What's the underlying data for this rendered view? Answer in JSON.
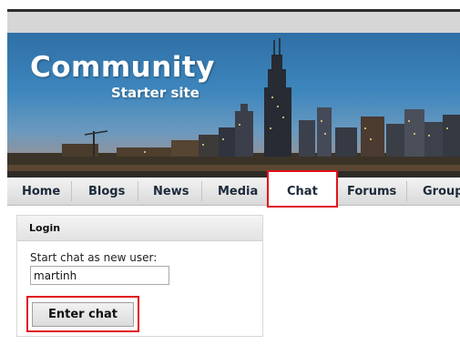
{
  "banner": {
    "title": "Community",
    "subtitle": "Starter site"
  },
  "nav": {
    "items": [
      {
        "label": "Home"
      },
      {
        "label": "Blogs"
      },
      {
        "label": "News"
      },
      {
        "label": "Media"
      },
      {
        "label": "Chat"
      },
      {
        "label": "Forums"
      },
      {
        "label": "Group"
      }
    ],
    "active": "Chat",
    "highlight_color": "#e0141b"
  },
  "login": {
    "title": "Login",
    "start_label": "Start chat as new user:",
    "username_value": "martinh",
    "enter_button": "Enter chat"
  }
}
